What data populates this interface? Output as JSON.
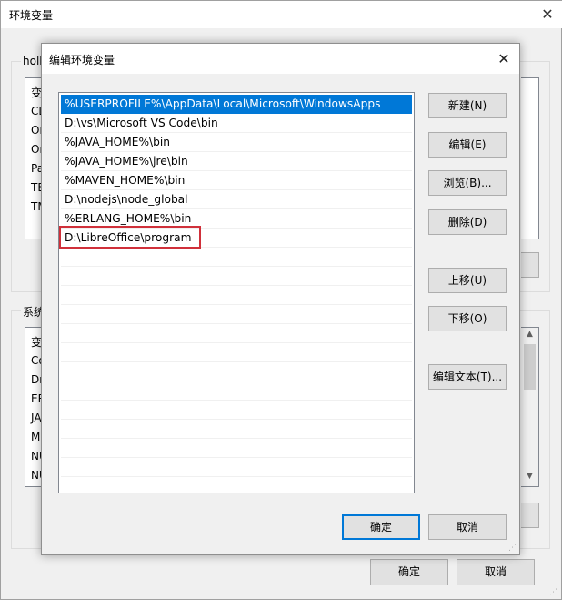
{
  "background_window": {
    "title": "环境变量",
    "user_group_label": "holle",
    "user_list_header": "变",
    "user_vars": [
      "CL",
      "On",
      "On",
      "Pa",
      "TE",
      "TM"
    ],
    "system_group_label": "系统",
    "system_list_header": "变",
    "system_vars": [
      "Co",
      "Dr",
      "ER",
      "JA",
      "M",
      "NU",
      "NU"
    ],
    "ok_label": "确定",
    "cancel_label": "取消"
  },
  "dialog": {
    "title": "编辑环境变量",
    "paths": [
      "%USERPROFILE%\\AppData\\Local\\Microsoft\\WindowsApps",
      "D:\\vs\\Microsoft VS Code\\bin",
      "%JAVA_HOME%\\bin",
      "%JAVA_HOME%\\jre\\bin",
      "%MAVEN_HOME%\\bin",
      "D:\\nodejs\\node_global",
      "%ERLANG_HOME%\\bin",
      "D:\\LibreOffice\\program"
    ],
    "selected_index": 0,
    "highlighted_index": 7,
    "buttons": {
      "new": "新建(N)",
      "edit": "编辑(E)",
      "browse": "浏览(B)...",
      "delete": "删除(D)",
      "move_up": "上移(U)",
      "move_down": "下移(O)",
      "edit_text": "编辑文本(T)..."
    },
    "ok_label": "确定",
    "cancel_label": "取消"
  },
  "colors": {
    "selection": "#0078d7",
    "highlight_border": "#d0303a"
  }
}
